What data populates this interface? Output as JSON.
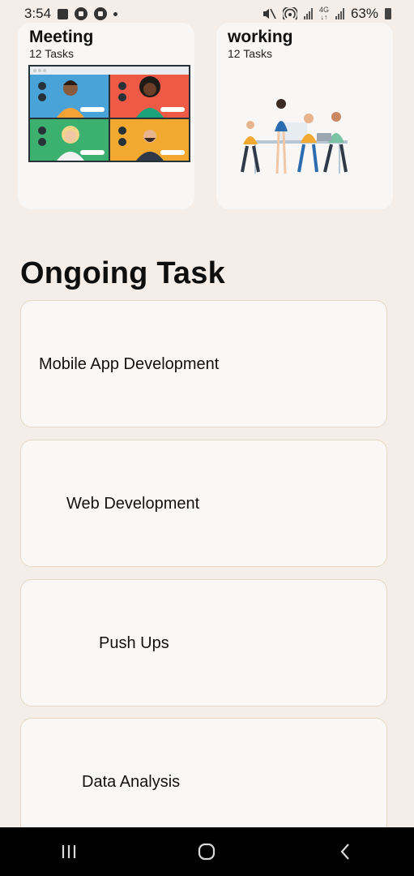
{
  "status_bar": {
    "time": "3:54",
    "network": "4G",
    "battery": "63%"
  },
  "categories": [
    {
      "title": "Meeting",
      "count": "12 Tasks",
      "image": "video-call-illustration"
    },
    {
      "title": "working",
      "count": "12 Tasks",
      "image": "team-working-illustration"
    }
  ],
  "ongoing": {
    "title": "Ongoing Task",
    "tasks": [
      {
        "label": "Mobile App Development"
      },
      {
        "label": "Web Development"
      },
      {
        "label": "Push Ups"
      },
      {
        "label": "Data Analysis"
      }
    ]
  },
  "nav": {
    "icons": [
      "recents-icon",
      "home-icon",
      "back-icon"
    ]
  },
  "colors": {
    "background": "#f5eee8",
    "card": "#faf8f6",
    "card_border": "#e8d8c4",
    "nav_bar": "#000000"
  }
}
